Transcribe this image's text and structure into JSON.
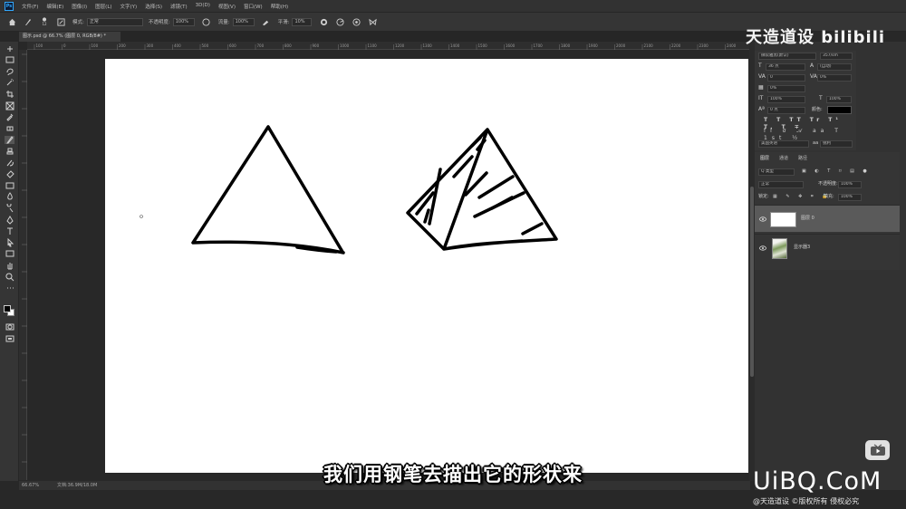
{
  "app": {
    "logo": "Ps"
  },
  "menu": [
    "文件(F)",
    "编辑(E)",
    "图像(I)",
    "图层(L)",
    "文字(Y)",
    "选择(S)",
    "滤镜(T)",
    "3D(D)",
    "视图(V)",
    "窗口(W)",
    "帮助(H)"
  ],
  "options": {
    "brush_size": "12",
    "mode_label": "模式:",
    "mode_value": "正常",
    "opacity_label": "不透明度:",
    "opacity_value": "100%",
    "flow_label": "流量:",
    "flow_value": "100%",
    "smoothing_label": "平滑:",
    "smoothing_value": "10%"
  },
  "document": {
    "tab_title": "图示.psd @ 66.7% (图层 0, RGB/8#) *"
  },
  "ruler_ticks": [
    "100",
    "0",
    "100",
    "200",
    "300",
    "400",
    "500",
    "600",
    "700",
    "800",
    "900",
    "1000",
    "1100",
    "1200",
    "1300",
    "1400",
    "1500",
    "1600",
    "1700",
    "1800",
    "1900",
    "2000",
    "2100",
    "2200",
    "2300",
    "2400",
    "2500"
  ],
  "status": {
    "zoom": "66.67%",
    "doc_info": "文档:36.9M/18.0M"
  },
  "character_panel": {
    "font_family": "微软雅黑(默认)",
    "font_style": "357/sm",
    "size": "36 点",
    "leading": "(自动)",
    "kerning": "0",
    "tracking": "0%",
    "vscale": "100%",
    "hscale": "100%",
    "baseline": "0 点",
    "color_label": "颜色:",
    "language": "美国英语",
    "aa": "aa",
    "aa_mode": "锐利"
  },
  "layers_panel": {
    "tabs": [
      "图层",
      "通道",
      "路径"
    ],
    "filter_label": "Q 类型",
    "blend_mode": "正常",
    "opacity_label": "不透明度:",
    "opacity_value": "100%",
    "lock_label": "锁定:",
    "fill_label": "填充:",
    "fill_value": "100%",
    "layers": [
      {
        "name": "图层 0",
        "selected": true
      },
      {
        "name": "显示器3",
        "selected": false
      }
    ]
  },
  "overlay": {
    "watermark": "天造道设 bilibili",
    "subtitle": "我们用钢笔去描出它的形状来",
    "site": "UiBQ.CoM",
    "credit": "@天造道设  ©版权所有 侵权必究"
  },
  "colors": {
    "accent": "#31a8ff",
    "canvas": "#ffffff",
    "ink": "#000000"
  }
}
